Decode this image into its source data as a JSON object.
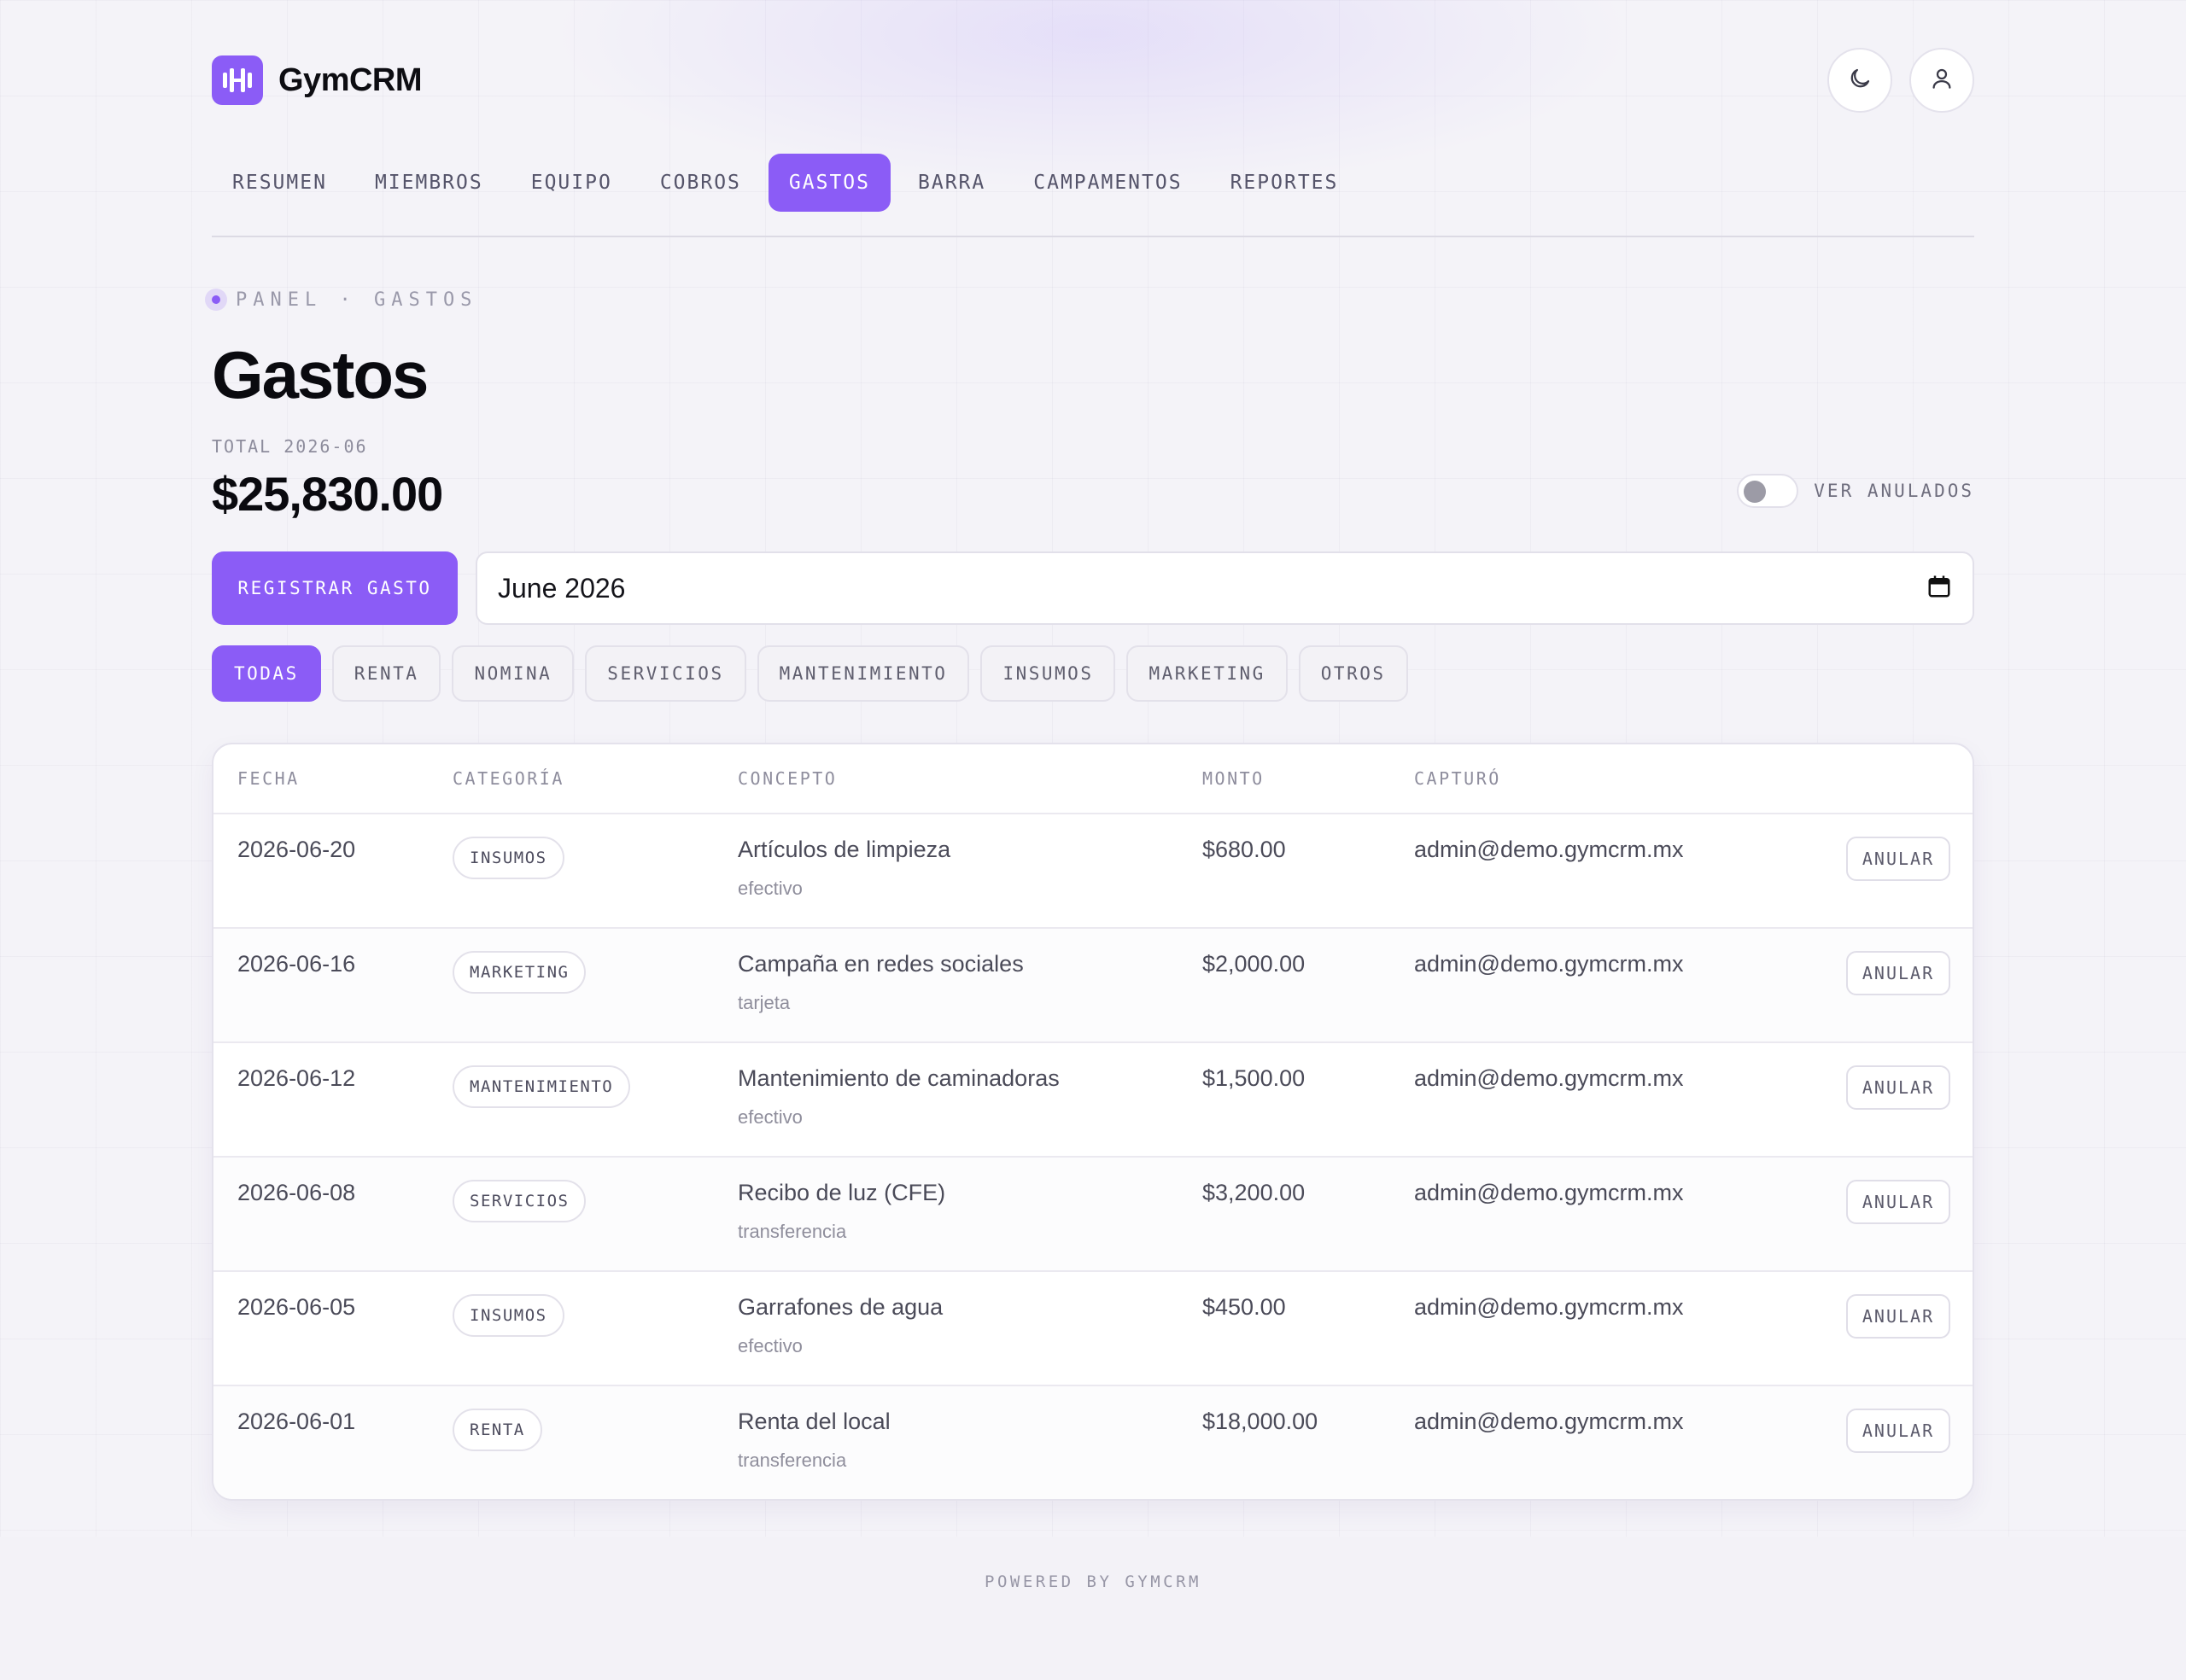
{
  "brand": {
    "name": "GymCRM",
    "logo_icon": "dumbbell-icon",
    "accent": "#8b5cf6"
  },
  "header": {
    "theme_icon": "moon-icon",
    "profile_icon": "user-icon"
  },
  "nav": {
    "items": [
      {
        "label": "RESUMEN",
        "active": false
      },
      {
        "label": "MIEMBROS",
        "active": false
      },
      {
        "label": "EQUIPO",
        "active": false
      },
      {
        "label": "COBROS",
        "active": false
      },
      {
        "label": "GASTOS",
        "active": true
      },
      {
        "label": "BARRA",
        "active": false
      },
      {
        "label": "CAMPAMENTOS",
        "active": false
      },
      {
        "label": "REPORTES",
        "active": false
      }
    ]
  },
  "breadcrumb": "PANEL · GASTOS",
  "page": {
    "title": "Gastos",
    "total_label": "TOTAL 2026-06",
    "total_value": "$25,830.00",
    "show_voided_label": "VER ANULADOS",
    "show_voided": false
  },
  "actions": {
    "register_label": "REGISTRAR GASTO",
    "month_value": "June 2026",
    "calendar_icon": "calendar-icon"
  },
  "filters": [
    {
      "label": "TODAS",
      "active": true
    },
    {
      "label": "RENTA",
      "active": false
    },
    {
      "label": "NOMINA",
      "active": false
    },
    {
      "label": "SERVICIOS",
      "active": false
    },
    {
      "label": "MANTENIMIENTO",
      "active": false
    },
    {
      "label": "INSUMOS",
      "active": false
    },
    {
      "label": "MARKETING",
      "active": false
    },
    {
      "label": "OTROS",
      "active": false
    }
  ],
  "table": {
    "columns": [
      "FECHA",
      "CATEGORÍA",
      "CONCEPTO",
      "MONTO",
      "CAPTURÓ"
    ],
    "rows": [
      {
        "date": "2026-06-20",
        "category": "INSUMOS",
        "concept": "Artículos de limpieza",
        "method": "efectivo",
        "amount": "$680.00",
        "user": "admin@demo.gymcrm.mx",
        "action": "ANULAR"
      },
      {
        "date": "2026-06-16",
        "category": "MARKETING",
        "concept": "Campaña en redes sociales",
        "method": "tarjeta",
        "amount": "$2,000.00",
        "user": "admin@demo.gymcrm.mx",
        "action": "ANULAR"
      },
      {
        "date": "2026-06-12",
        "category": "MANTENIMIENTO",
        "concept": "Mantenimiento de caminadoras",
        "method": "efectivo",
        "amount": "$1,500.00",
        "user": "admin@demo.gymcrm.mx",
        "action": "ANULAR"
      },
      {
        "date": "2026-06-08",
        "category": "SERVICIOS",
        "concept": "Recibo de luz (CFE)",
        "method": "transferencia",
        "amount": "$3,200.00",
        "user": "admin@demo.gymcrm.mx",
        "action": "ANULAR"
      },
      {
        "date": "2026-06-05",
        "category": "INSUMOS",
        "concept": "Garrafones de agua",
        "method": "efectivo",
        "amount": "$450.00",
        "user": "admin@demo.gymcrm.mx",
        "action": "ANULAR"
      },
      {
        "date": "2026-06-01",
        "category": "RENTA",
        "concept": "Renta del local",
        "method": "transferencia",
        "amount": "$18,000.00",
        "user": "admin@demo.gymcrm.mx",
        "action": "ANULAR"
      }
    ]
  },
  "footer": "POWERED BY GYMCRM"
}
